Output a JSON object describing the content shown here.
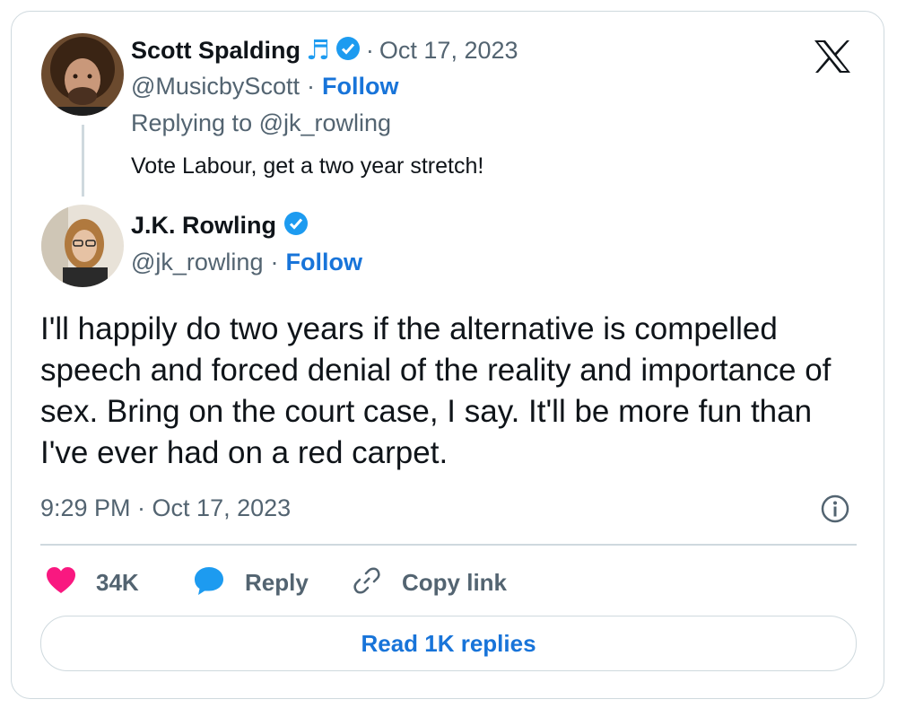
{
  "parent_tweet": {
    "author_name": "Scott Spalding",
    "music_icon": "♬",
    "separator": "·",
    "date": "Oct 17, 2023",
    "handle": "@MusicbyScott",
    "follow_label": "Follow",
    "replying_to": "Replying to @jk_rowling",
    "text": "Vote Labour, get a two year stretch!"
  },
  "main_tweet": {
    "author_name": "J.K. Rowling",
    "handle": "@jk_rowling",
    "separator": "·",
    "follow_label": "Follow",
    "text": "I'll happily do two years if the alternative is compelled speech and forced denial of the reality and importance of sex. Bring on the court case, I say. It'll be more fun than I've ever had on a red carpet.",
    "timestamp": "9:29 PM · Oct 17, 2023"
  },
  "actions": {
    "likes": "34K",
    "reply_label": "Reply",
    "copy_link_label": "Copy link"
  },
  "read_replies_label": "Read 1K replies",
  "brand_logo": "X",
  "colors": {
    "verified": "#1d9bf0",
    "follow": "#1874d9",
    "heart": "#f91880",
    "reply_bubble": "#1d9bf0",
    "muted": "#536471"
  }
}
